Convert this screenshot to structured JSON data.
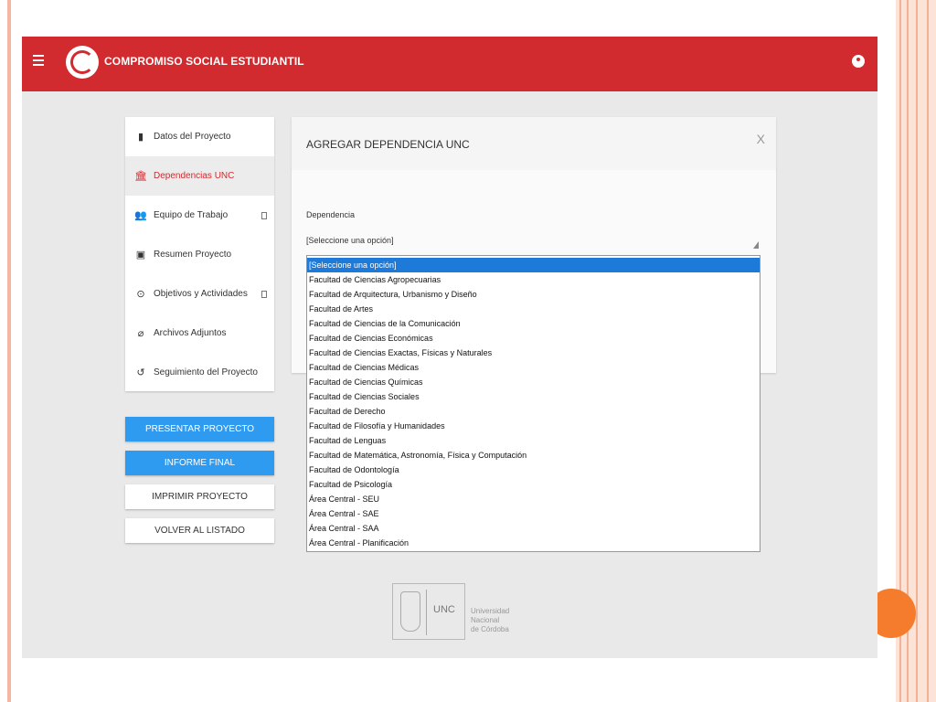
{
  "header": {
    "app_title": "COMPROMISO SOCIAL ESTUDIANTIL",
    "accent_color": "#d12a2f"
  },
  "sidebar": {
    "items": [
      {
        "label": "Datos del Proyecto",
        "icon": "document-icon"
      },
      {
        "label": "Dependencias UNC",
        "icon": "institution-icon",
        "active": true
      },
      {
        "label": "Equipo de Trabajo",
        "icon": "people-icon"
      },
      {
        "label": "Resumen Proyecto",
        "icon": "clipboard-icon"
      },
      {
        "label": "Objetivos y Actividades",
        "icon": "target-icon"
      },
      {
        "label": "Archivos Adjuntos",
        "icon": "paperclip-icon"
      },
      {
        "label": "Seguimiento del Proyecto",
        "icon": "history-icon"
      }
    ]
  },
  "actions": {
    "presentar": "PRESENTAR PROYECTO",
    "informe": "INFORME FINAL",
    "imprimir": "IMPRIMIR PROYECTO",
    "volver": "VOLVER AL LISTADO",
    "primary_color": "#2f9bf0"
  },
  "modal": {
    "title": "AGREGAR DEPENDENCIA UNC",
    "close": "X",
    "field_label": "Dependencia",
    "selected_value": "[Seleccione una opción]"
  },
  "dropdown": {
    "options": [
      "[Seleccione una opción]",
      "Facultad de Ciencias Agropecuarias",
      "Facultad de Arquitectura, Urbanismo y Diseño",
      "Facultad de Artes",
      "Facultad de Ciencias de la Comunicación",
      "Facultad de Ciencias Económicas",
      "Facultad de Ciencias Exactas, Físicas y Naturales",
      "Facultad de Ciencias Médicas",
      "Facultad de Ciencias Químicas",
      "Facultad de Ciencias Sociales",
      "Facultad de Derecho",
      "Facultad de Filosofía y Humanidades",
      "Facultad de Lenguas",
      "Facultad de Matemática, Astronomía, Física y Computación",
      "Facultad de Odontología",
      "Facultad de Psicología",
      "Área Central - SEU",
      "Área Central - SAE",
      "Área Central - SAA",
      "Área Central - Planificación"
    ]
  },
  "footer": {
    "unc": "UNC",
    "line1": "Universidad",
    "line2": "Nacional",
    "line3": "de Córdoba"
  }
}
